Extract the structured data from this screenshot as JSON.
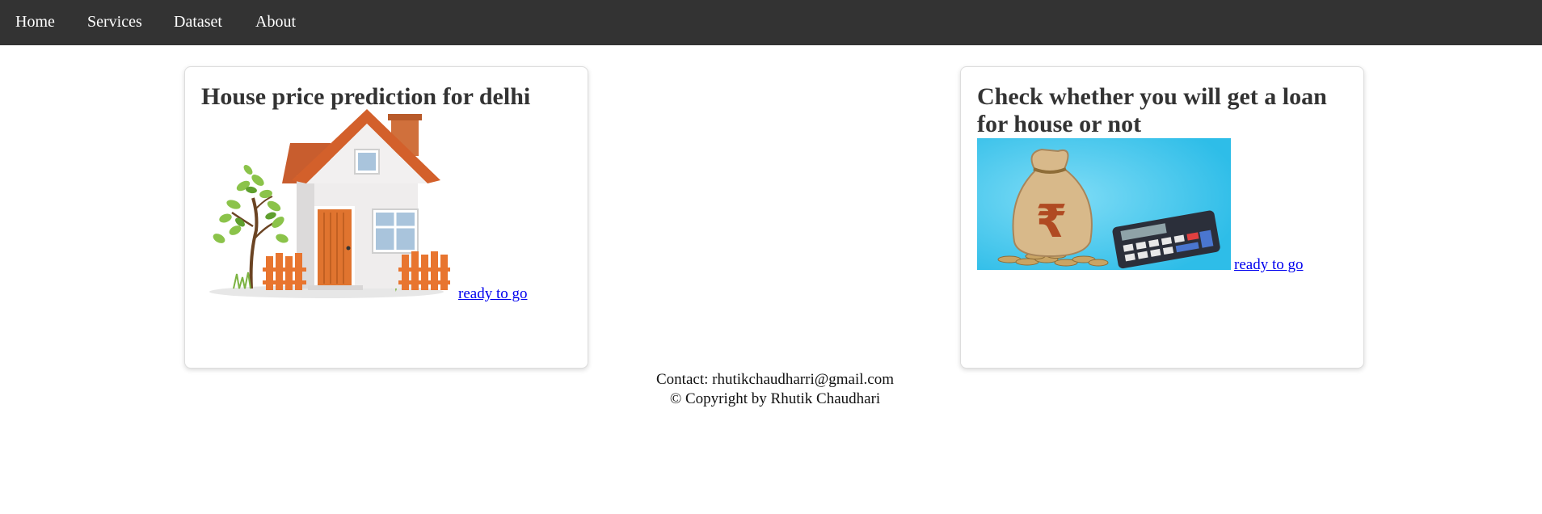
{
  "nav": {
    "items": [
      {
        "label": "Home"
      },
      {
        "label": "Services"
      },
      {
        "label": "Dataset"
      },
      {
        "label": "About"
      }
    ]
  },
  "cards": [
    {
      "title": "House price prediction for delhi",
      "image_icon": "house-illustration",
      "link_label": "ready to go"
    },
    {
      "title": "Check whether you will get a loan for house or not",
      "image_icon": "rupee-money-bag-and-calculator",
      "link_label": "ready to go"
    }
  ],
  "footer": {
    "contact": "Contact: rhutikchaudharri@gmail.com",
    "copyright": "© Copyright by Rhutik Chaudhari"
  },
  "colors": {
    "navbar_bg": "#333333",
    "nav_text": "#ffffff",
    "title_text": "#333333",
    "link": "#0000ee",
    "loan_image_bg": "#3fc6ec"
  }
}
